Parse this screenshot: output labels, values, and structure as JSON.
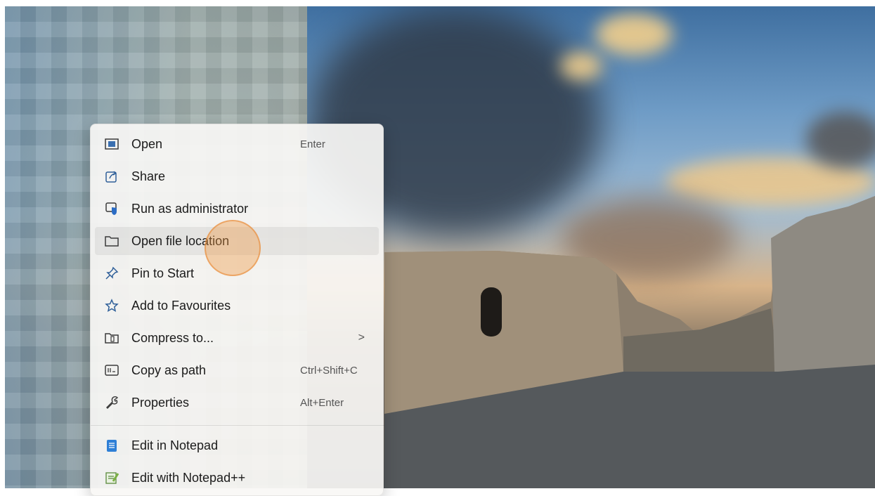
{
  "context_menu": {
    "items": [
      {
        "label": "Open",
        "shortcut": "Enter",
        "icon": "open-window-icon"
      },
      {
        "label": "Share",
        "shortcut": "",
        "icon": "share-icon"
      },
      {
        "label": "Run as administrator",
        "shortcut": "",
        "icon": "shield-admin-icon"
      },
      {
        "label": "Open file location",
        "shortcut": "",
        "icon": "folder-icon"
      },
      {
        "label": "Pin to Start",
        "shortcut": "",
        "icon": "pin-icon"
      },
      {
        "label": "Add to Favourites",
        "shortcut": "",
        "icon": "star-icon"
      },
      {
        "label": "Compress to...",
        "shortcut": "",
        "icon": "zip-folder-icon",
        "submenu": ">"
      },
      {
        "label": "Copy as path",
        "shortcut": "Ctrl+Shift+C",
        "icon": "copy-path-icon"
      },
      {
        "label": "Properties",
        "shortcut": "Alt+Enter",
        "icon": "wrench-icon"
      },
      {
        "label": "Edit in Notepad",
        "shortcut": "",
        "icon": "notepad-icon"
      },
      {
        "label": "Edit with Notepad++",
        "shortcut": "",
        "icon": "notepad-plus-plus-icon"
      }
    ]
  },
  "colors": {
    "accent": "#1a73c9",
    "hover_ring": "#f0963c"
  }
}
